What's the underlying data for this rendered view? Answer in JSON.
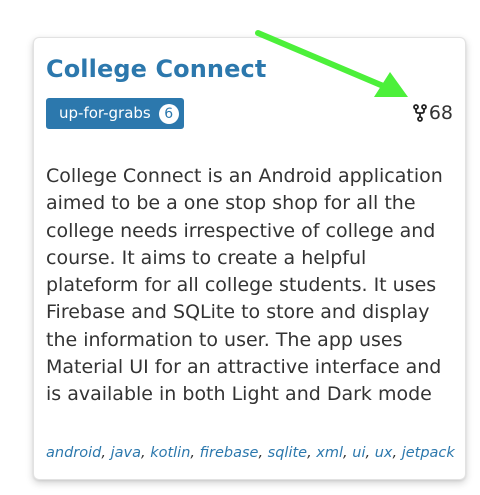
{
  "card": {
    "title": "College Connect",
    "label": {
      "name": "up-for-grabs",
      "count": "6"
    },
    "forks": {
      "icon": "fork-icon",
      "count": "68"
    },
    "description": "College Connect is an Android application aimed to be a one stop shop for all the college needs irrespective of college and course. It aims to create a helpful plateform for all college students. It uses Firebase and SQLite to store and display the information to user. The app uses Material UI for an attractive interface and is available in both Light and Dark mode",
    "tags": [
      "android",
      "java",
      "kotlin",
      "firebase",
      "sqlite",
      "xml",
      "ui",
      "ux",
      "jetpack"
    ]
  },
  "colors": {
    "accent": "#2c78ad",
    "text": "#333333",
    "annotation_arrow": "#4cf03a"
  }
}
